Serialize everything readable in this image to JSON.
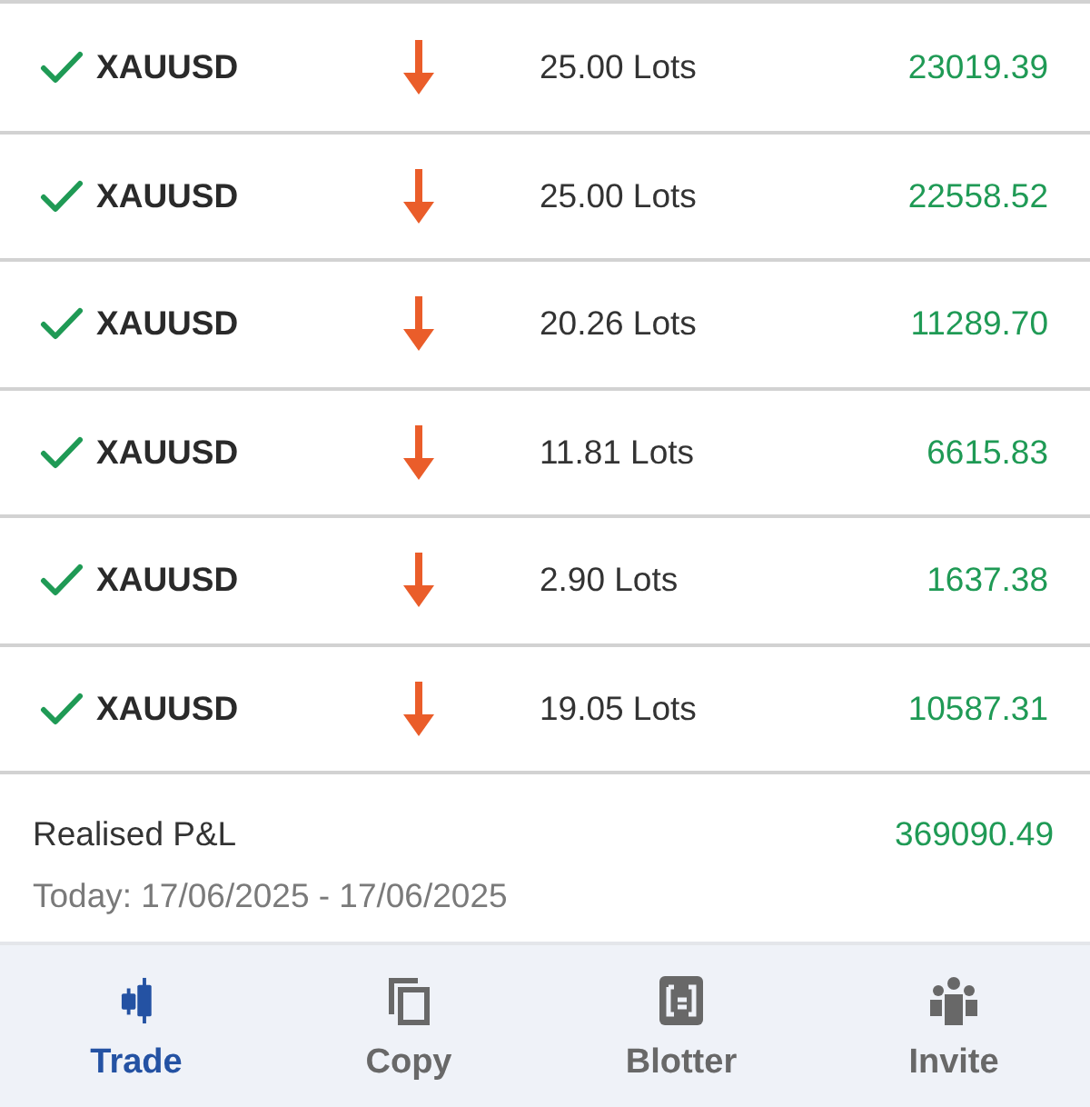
{
  "trades": [
    {
      "symbol": "XAUUSD",
      "kind": "sell",
      "lots": "25.00 Lots",
      "pnl": "23019.39"
    },
    {
      "symbol": "XAUUSD",
      "kind": "sell",
      "lots": "25.00 Lots",
      "pnl": "22558.52"
    },
    {
      "symbol": "XAUUSD",
      "kind": "sell",
      "lots": "20.26 Lots",
      "pnl": "11289.70"
    },
    {
      "symbol": "XAUUSD",
      "kind": "sell",
      "lots": "11.81 Lots",
      "pnl": "6615.83"
    },
    {
      "symbol": "XAUUSD",
      "kind": "sell",
      "lots": "2.90 Lots",
      "pnl": "1637.38"
    },
    {
      "symbol": "XAUUSD",
      "kind": "sell",
      "lots": "19.05 Lots",
      "pnl": "10587.31"
    }
  ],
  "summary": {
    "label": "Realised P&L",
    "value": "369090.49",
    "period": "Today: 17/06/2025 - 17/06/2025"
  },
  "nav": [
    {
      "kind": "trade",
      "label": "Trade",
      "selected": true
    },
    {
      "kind": "copy",
      "label": "Copy",
      "selected": false
    },
    {
      "kind": "blotter",
      "label": "Blotter",
      "selected": false
    },
    {
      "kind": "invite",
      "label": "Invite",
      "selected": false
    }
  ]
}
